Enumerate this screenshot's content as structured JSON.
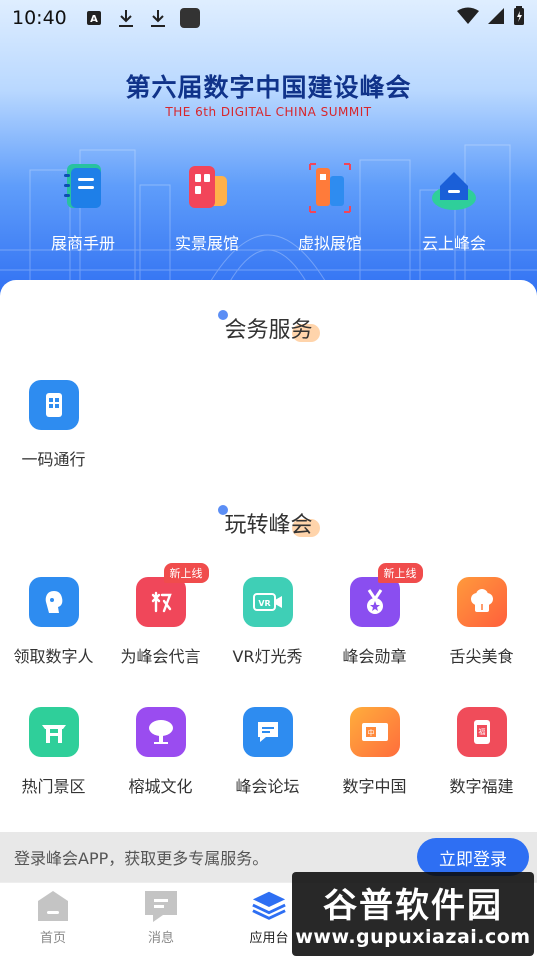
{
  "status_bar": {
    "time": "10:40",
    "left_icons": [
      "font-a-icon",
      "download-icon",
      "download-icon",
      "app-square-icon"
    ],
    "right_icons": [
      "wifi-icon",
      "cell-signal-icon",
      "battery-icon"
    ]
  },
  "header": {
    "title": "第六届数字中国建设峰会",
    "subtitle": "THE 6th DIGITAL CHINA SUMMIT",
    "features": [
      {
        "label": "展商手册",
        "icon": "notebook-icon"
      },
      {
        "label": "实景展馆",
        "icon": "building-icon"
      },
      {
        "label": "虚拟展馆",
        "icon": "virtual-building-icon"
      },
      {
        "label": "云上峰会",
        "icon": "cloud-home-icon"
      }
    ]
  },
  "section_meeting": {
    "title": "会务服务",
    "items": [
      {
        "label": "一码通行",
        "icon": "qr-pass-icon",
        "color": "#2e8cf0"
      }
    ]
  },
  "section_fun": {
    "title": "玩转峰会",
    "items": [
      {
        "label": "领取数字人",
        "icon": "digital-human-icon",
        "color": "#2e8cf0",
        "badge": ""
      },
      {
        "label": "为峰会代言",
        "icon": "endorse-icon",
        "color": "#f0475a",
        "badge": "新上线"
      },
      {
        "label": "VR灯光秀",
        "icon": "vr-camera-icon",
        "color": "#3fcfb6",
        "badge": ""
      },
      {
        "label": "峰会勋章",
        "icon": "medal-icon",
        "color": "#8a4ef0",
        "badge": "新上线"
      },
      {
        "label": "舌尖美食",
        "icon": "food-icon",
        "color": "#ff7a3c",
        "badge": ""
      },
      {
        "label": "热门景区",
        "icon": "scenic-gate-icon",
        "color": "#2fcf9a",
        "badge": ""
      },
      {
        "label": "榕城文化",
        "icon": "banyan-tree-icon",
        "color": "#9a4cf0",
        "badge": ""
      },
      {
        "label": "峰会论坛",
        "icon": "forum-chat-icon",
        "color": "#2e8cf0",
        "badge": ""
      },
      {
        "label": "数字中国",
        "icon": "digital-china-icon",
        "color": "#ff8a3c",
        "badge": ""
      },
      {
        "label": "数字福建",
        "icon": "digital-fujian-icon",
        "color": "#f04c5a",
        "badge": ""
      }
    ]
  },
  "login_banner": {
    "message": "登录峰会APP，获取更多专属服务。",
    "button": "立即登录"
  },
  "bottom_nav": {
    "items": [
      {
        "label": "首页",
        "icon": "home-icon",
        "active": false
      },
      {
        "label": "消息",
        "icon": "message-icon",
        "active": false
      },
      {
        "label": "应用台",
        "icon": "layers-icon",
        "active": true
      }
    ]
  },
  "watermark": {
    "logo": "谷普软件园",
    "url": "www.gupuxiazai.com"
  },
  "colors": {
    "accent": "#2e6ff3",
    "header_text": "#10338a",
    "subtitle_red": "#d8262c"
  }
}
